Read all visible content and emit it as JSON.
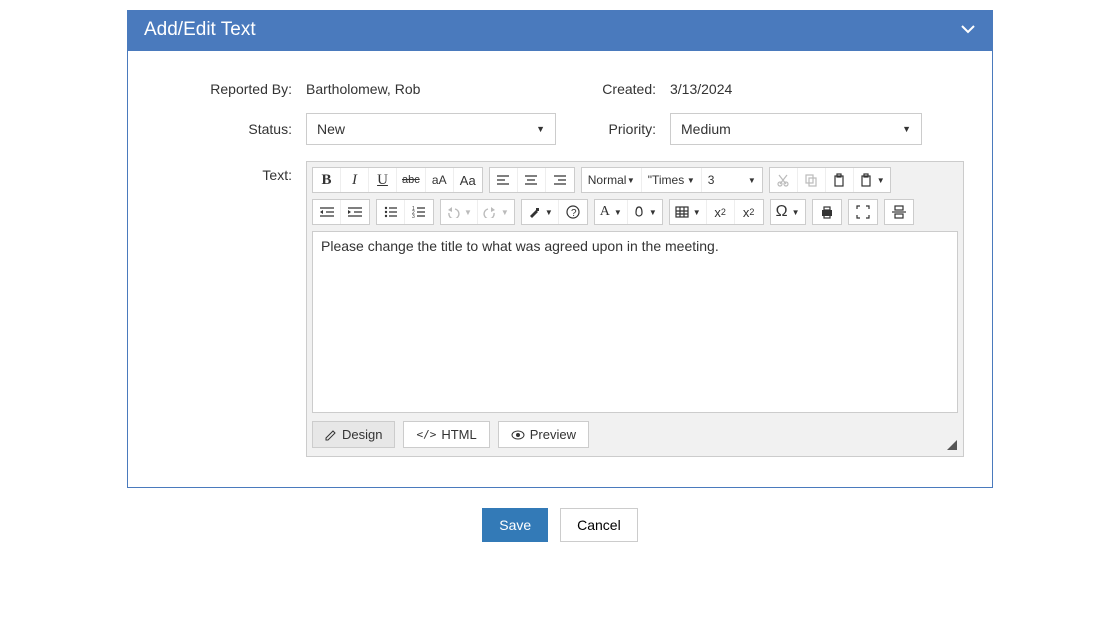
{
  "header": {
    "title": "Add/Edit Text"
  },
  "fields": {
    "reported_by_label": "Reported By:",
    "reported_by_value": "Bartholomew, Rob",
    "created_label": "Created:",
    "created_value": "3/13/2024",
    "status_label": "Status:",
    "status_value": "New",
    "priority_label": "Priority:",
    "priority_value": "Medium",
    "text_label": "Text:"
  },
  "toolbar": {
    "paragraph": "Normal",
    "font_family": "\"Times ...",
    "font_size": "3",
    "case_small_caps": "aA",
    "case_title": "Aa",
    "strike_label": "abc",
    "omega": "Ω",
    "font_color_letter": "A",
    "subscript": "x",
    "subscript_sub": "2",
    "superscript": "x",
    "superscript_sup": "2"
  },
  "editor": {
    "content": "Please change the title to what was agreed upon in the meeting."
  },
  "tabs": {
    "design": "Design",
    "html": "HTML",
    "preview": "Preview"
  },
  "footer": {
    "save": "Save",
    "cancel": "Cancel"
  }
}
